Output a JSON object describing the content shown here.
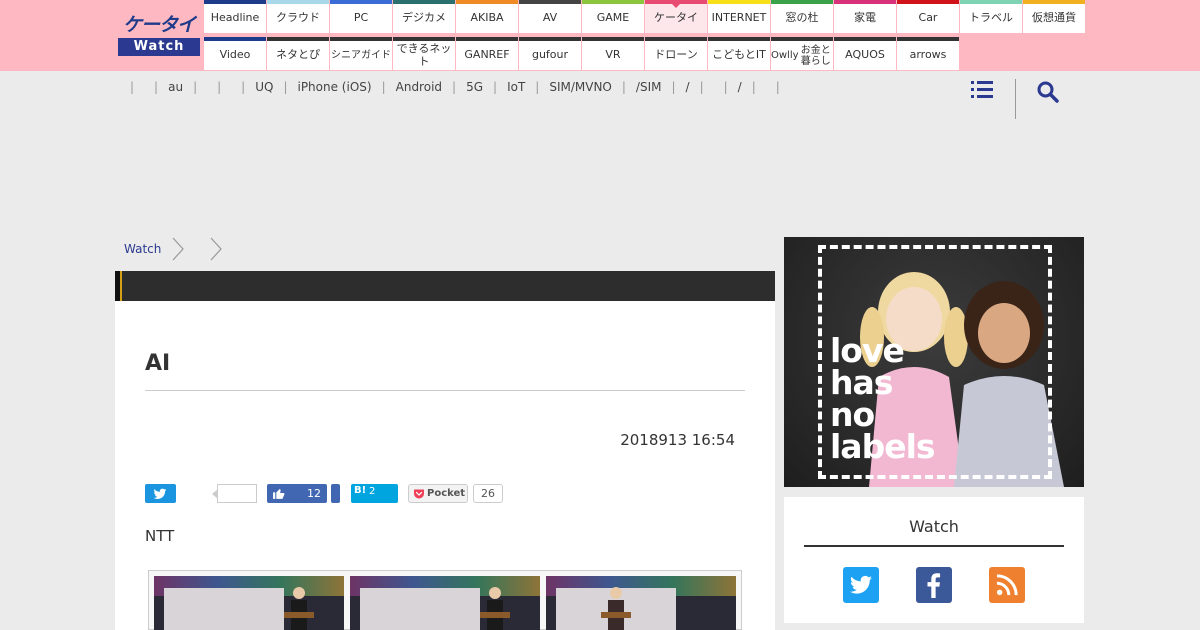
{
  "header": {
    "logo_top": "ケータイ",
    "logo_bottom": "Watch",
    "nav_row1": [
      {
        "label": "Headline",
        "color": "#1e3a8a"
      },
      {
        "label": "クラウド",
        "color": "#a8d8ea"
      },
      {
        "label": "PC",
        "color": "#3b6bd6"
      },
      {
        "label": "デジカメ",
        "color": "#2b6f6f"
      },
      {
        "label": "AKIBA",
        "color": "#f08a24"
      },
      {
        "label": "AV",
        "color": "#444444"
      },
      {
        "label": "GAME",
        "color": "#8cc63f"
      },
      {
        "label": "ケータイ",
        "color": "#e84b72",
        "active": true
      },
      {
        "label": "INTERNET",
        "color": "#f7e017"
      },
      {
        "label": "窓の杜",
        "color": "#3aa34a"
      },
      {
        "label": "家電",
        "color": "#d8337a"
      },
      {
        "label": "Car",
        "color": "#d0121b"
      },
      {
        "label": "トラベル",
        "color": "#7ed3b2"
      },
      {
        "label": "仮想通貨",
        "color": "#f0b020"
      }
    ],
    "nav_row2": [
      {
        "label": "Video",
        "color": "#1e3a8a"
      },
      {
        "label": "ネタとぴ",
        "color": "#333333"
      },
      {
        "label": "シニア\nガイド",
        "color": "#333333"
      },
      {
        "label": "できるネット",
        "color": "#333333"
      },
      {
        "label": "GANREF",
        "color": "#333333"
      },
      {
        "label": "gufour",
        "color": "#333333"
      },
      {
        "label": "VR",
        "color": "#333333"
      },
      {
        "label": "ドローン",
        "color": "#333333"
      },
      {
        "label": "こどもとIT",
        "color": "#333333"
      },
      {
        "label": "Owlly\nお金と暮らし",
        "color": "#333333"
      },
      {
        "label": "AQUOS",
        "color": "#333333"
      },
      {
        "label": "arrows",
        "color": "#333333"
      }
    ]
  },
  "subnav": {
    "items": [
      "",
      "au",
      "",
      "",
      "UQ",
      "iPhone (iOS)",
      "Android",
      "5G",
      "IoT",
      "SIM/MVNO",
      "/SIM",
      "/",
      "",
      "/",
      ""
    ]
  },
  "breadcrumb": {
    "home": "Watch",
    "level2": ""
  },
  "article": {
    "title": "AI",
    "date": "2018913 16:54",
    "share": {
      "like_count": "12",
      "hatena_mark": "B!",
      "hatena_count": "2",
      "pocket_label": "Pocket",
      "pocket_count": "26"
    },
    "lead": "NTT"
  },
  "sidebar": {
    "ad_slogan": [
      "love",
      "has",
      "no",
      "labels"
    ],
    "follow_title": "Watch"
  }
}
